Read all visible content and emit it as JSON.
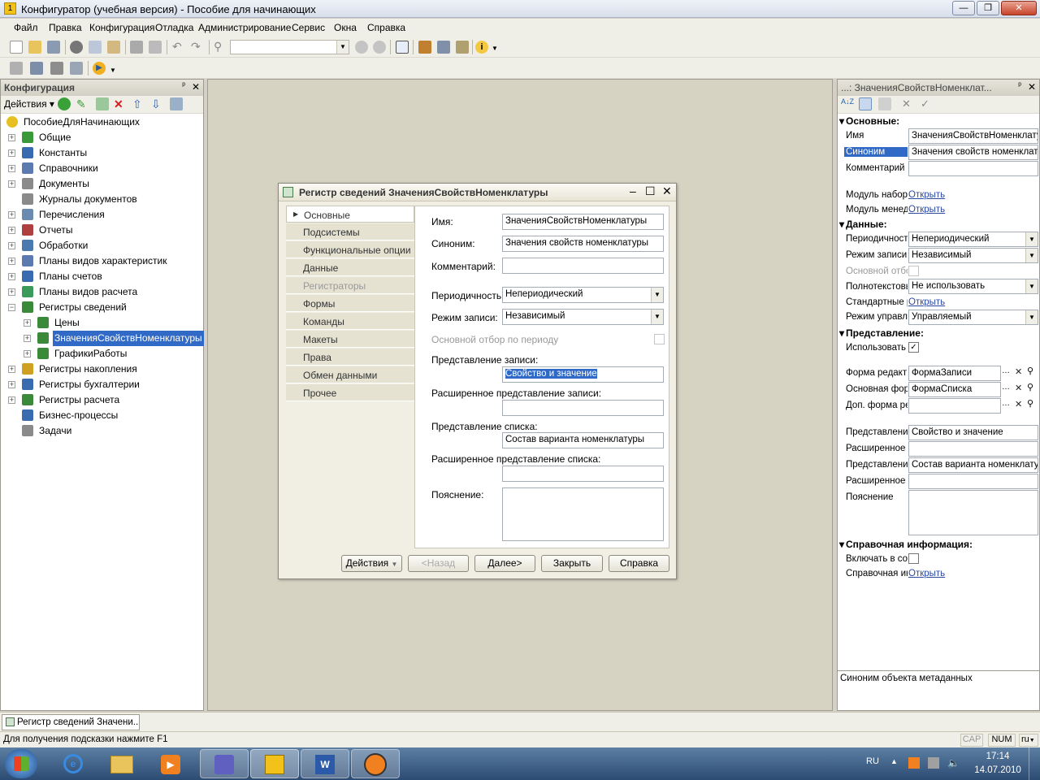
{
  "window": {
    "title": "Конфигуратор (учебная версия) - Пособие для начинающих"
  },
  "menu": [
    "Файл",
    "Правка",
    "Конфигурация",
    "Отладка",
    "Администрирование",
    "Сервис",
    "Окна",
    "Справка"
  ],
  "config_panel": {
    "title": "Конфигурация",
    "actions_label": "Действия",
    "tree": [
      {
        "label": "ПособиеДляНачинающих",
        "level": 0,
        "exp": "",
        "icon": "#e6c020"
      },
      {
        "label": "Общие",
        "level": 1,
        "exp": "+",
        "icon": "#3a9a3a"
      },
      {
        "label": "Константы",
        "level": 1,
        "exp": "+",
        "icon": "#3a6ab0"
      },
      {
        "label": "Справочники",
        "level": 1,
        "exp": "+",
        "icon": "#5a7ab0"
      },
      {
        "label": "Документы",
        "level": 1,
        "exp": "+",
        "icon": "#8a8a8a"
      },
      {
        "label": "Журналы документов",
        "level": 1,
        "exp": "",
        "icon": "#8a8a8a"
      },
      {
        "label": "Перечисления",
        "level": 1,
        "exp": "+",
        "icon": "#6a8ab0"
      },
      {
        "label": "Отчеты",
        "level": 1,
        "exp": "+",
        "icon": "#b04040"
      },
      {
        "label": "Обработки",
        "level": 1,
        "exp": "+",
        "icon": "#4a7ab0"
      },
      {
        "label": "Планы видов характеристик",
        "level": 1,
        "exp": "+",
        "icon": "#5a7ab0"
      },
      {
        "label": "Планы счетов",
        "level": 1,
        "exp": "+",
        "icon": "#3a6ab0"
      },
      {
        "label": "Планы видов расчета",
        "level": 1,
        "exp": "+",
        "icon": "#3a9a5a"
      },
      {
        "label": "Регистры сведений",
        "level": 1,
        "exp": "-",
        "icon": "#3a8a3a"
      },
      {
        "label": "Цены",
        "level": 2,
        "exp": "+",
        "icon": "#3a8a3a"
      },
      {
        "label": "ЗначенияСвойствНоменклатуры",
        "level": 2,
        "exp": "+",
        "icon": "#3a8a3a",
        "selected": true
      },
      {
        "label": "ГрафикиРаботы",
        "level": 2,
        "exp": "+",
        "icon": "#3a8a3a"
      },
      {
        "label": "Регистры накопления",
        "level": 1,
        "exp": "+",
        "icon": "#d0a020"
      },
      {
        "label": "Регистры бухгалтерии",
        "level": 1,
        "exp": "+",
        "icon": "#3a6ab0"
      },
      {
        "label": "Регистры расчета",
        "level": 1,
        "exp": "+",
        "icon": "#3a8a3a"
      },
      {
        "label": "Бизнес-процессы",
        "level": 1,
        "exp": "",
        "icon": "#3a6ab0"
      },
      {
        "label": "Задачи",
        "level": 1,
        "exp": "",
        "icon": "#8a8a8a"
      }
    ]
  },
  "dialog": {
    "title": "Регистр сведений ЗначенияСвойствНоменклатуры",
    "tabs": [
      {
        "label": "Основные",
        "state": "active"
      },
      {
        "label": "Подсистемы",
        "state": ""
      },
      {
        "label": "Функциональные опции",
        "state": ""
      },
      {
        "label": "Данные",
        "state": ""
      },
      {
        "label": "Регистраторы",
        "state": "dis"
      },
      {
        "label": "Формы",
        "state": ""
      },
      {
        "label": "Команды",
        "state": ""
      },
      {
        "label": "Макеты",
        "state": ""
      },
      {
        "label": "Права",
        "state": ""
      },
      {
        "label": "Обмен данными",
        "state": ""
      },
      {
        "label": "Прочее",
        "state": ""
      }
    ],
    "fields": {
      "name_label": "Имя:",
      "name_value": "ЗначенияСвойствНоменклатуры",
      "synonym_label": "Синоним:",
      "synonym_value": "Значения свойств номенклатуры",
      "comment_label": "Комментарий:",
      "comment_value": "",
      "periodicity_label": "Периодичность:",
      "periodicity_value": "Непериодический",
      "write_mode_label": "Режим записи:",
      "write_mode_value": "Независимый",
      "main_filter_label": "Основной отбор по периоду",
      "record_repr_label": "Представление записи:",
      "record_repr_value": "Свойство и значение",
      "ext_record_repr_label": "Расширенное представление записи:",
      "ext_record_repr_value": "",
      "list_repr_label": "Представление списка:",
      "list_repr_value": "Состав варианта номенклатуры",
      "ext_list_repr_label": "Расширенное представление списка:",
      "ext_list_repr_value": "",
      "explanation_label": "Пояснение:",
      "explanation_value": ""
    },
    "buttons": {
      "actions": "Действия",
      "back": "<Назад",
      "next": "Далее>",
      "close": "Закрыть",
      "help": "Справка"
    }
  },
  "properties": {
    "title": "...: ЗначенияСвойствНоменклат...",
    "sections": {
      "main": "Основные:",
      "data": "Данные:",
      "presentation": "Представление:",
      "help_info": "Справочная информация:"
    },
    "labels": {
      "name": "Имя",
      "synonym": "Синоним",
      "comment": "Комментарий",
      "module_set": "Модуль набора",
      "module_mgr": "Модуль менеджера",
      "periodicity": "Периодичность",
      "write_mode": "Режим записи",
      "main_filter": "Основной отбор",
      "fulltext": "Полнотекстовый",
      "std_attr": "Стандартные реквизиты",
      "data_lock": "Режим управления",
      "use": "Использовать",
      "edit_form": "Форма редакт",
      "main_form": "Основная форм",
      "add_form": "Доп. форма ре",
      "record_repr": "Представление",
      "ext_record_repr": "Расширенное п",
      "list_repr": "Представление",
      "ext_list_repr": "Расширенное п",
      "explanation": "Пояснение",
      "include_help": "Включать в содержание",
      "help_info": "Справочная информация"
    },
    "values": {
      "name": "ЗначенияСвойствНоменклатуры",
      "synonym": "Значения свойств номенклатуры",
      "comment": "",
      "open": "Открыть",
      "periodicity": "Непериодический",
      "write_mode": "Независимый",
      "fulltext": "Не использовать",
      "data_lock": "Управляемый",
      "edit_form": "ФормаЗаписи",
      "main_form": "ФормаСписка",
      "add_form": "",
      "record_repr": "Свойство и значение",
      "ext_record_repr": "",
      "list_repr": "Состав варианта номенклатуры",
      "ext_list_repr": "",
      "explanation": ""
    },
    "hint": "Синоним объекта метаданных"
  },
  "window_tab": "Регистр сведений Значени...",
  "status": {
    "text": "Для получения подсказки нажмите F1",
    "cap": "CAP",
    "num": "NUM",
    "lang": "ru"
  },
  "taskbar": {
    "lang": "RU",
    "time": "17:14",
    "date": "14.07.2010"
  }
}
